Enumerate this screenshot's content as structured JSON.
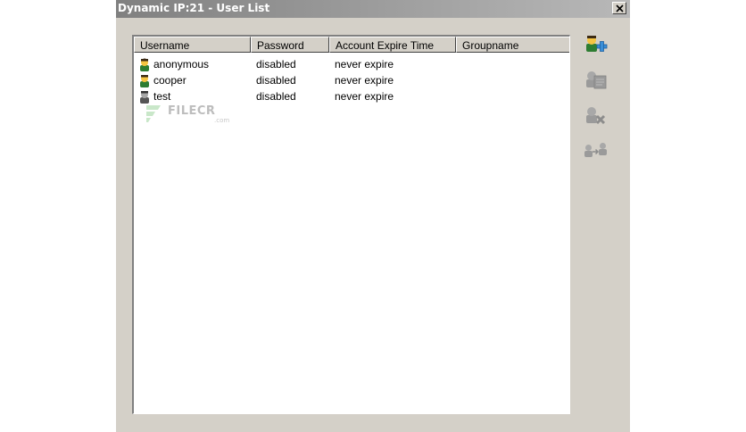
{
  "window": {
    "title": "Dynamic IP:21 - User List"
  },
  "list": {
    "columns": [
      "Username",
      "Password",
      "Account Expire Time",
      "Groupname"
    ],
    "rows": [
      {
        "username": "anonymous",
        "password": "disabled",
        "expire": "never expire",
        "group": "",
        "icon": "user-active-icon"
      },
      {
        "username": "cooper",
        "password": "disabled",
        "expire": "never expire",
        "group": "",
        "icon": "user-active-icon"
      },
      {
        "username": "test",
        "password": "disabled",
        "expire": "never expire",
        "group": "",
        "icon": "user-disabled-icon"
      }
    ]
  },
  "toolbar": {
    "buttons": [
      "add-user-icon",
      "edit-user-icon",
      "delete-user-icon",
      "copy-user-icon"
    ]
  },
  "watermark": {
    "text": "FILECR",
    "sub": ".com"
  },
  "colors": {
    "dialog_bg": "#d4d0c8",
    "title_gradient_start": "#808080",
    "add_accent": "#3a8fd8",
    "user_skin": "#f5c542",
    "user_body": "#2e7d32"
  }
}
